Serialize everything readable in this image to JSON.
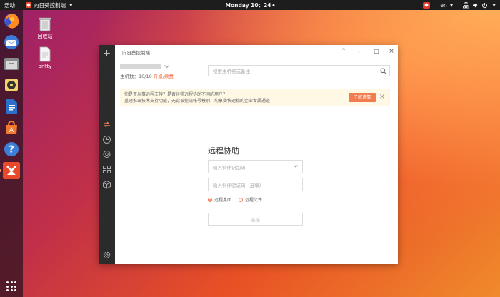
{
  "topbar": {
    "activities": "活动",
    "app_name": "向日葵控制端",
    "clock": "Monday 10：24",
    "lang": "en"
  },
  "desktop": {
    "trash_label": "回收站",
    "file_label": "brltty"
  },
  "window": {
    "title": "向日葵控制端",
    "host_count_label": "主机数：10/10",
    "upgrade_link": "升级/续费",
    "search_placeholder": "搜索主机名或备注",
    "notice": {
      "line1": "你是否从事远程支持？是否经常远程协助不同的用户？",
      "line2": "重磅推出技术支持功能，无论被控端帐号模别，均享受快速稳的企业专属通道",
      "button": "了解详情"
    },
    "assist": {
      "title": "远程协助",
      "partner_code_placeholder": "输入伙伴识别码",
      "verify_code_placeholder": "输入伙伴验证码（选填）",
      "radio_desktop": "远程桌面",
      "radio_file": "远程文件",
      "connect_button": "连接"
    }
  },
  "colors": {
    "accent": "#f07c50",
    "sidebar": "#2b2b2b",
    "topbar": "#1d1d1d"
  }
}
